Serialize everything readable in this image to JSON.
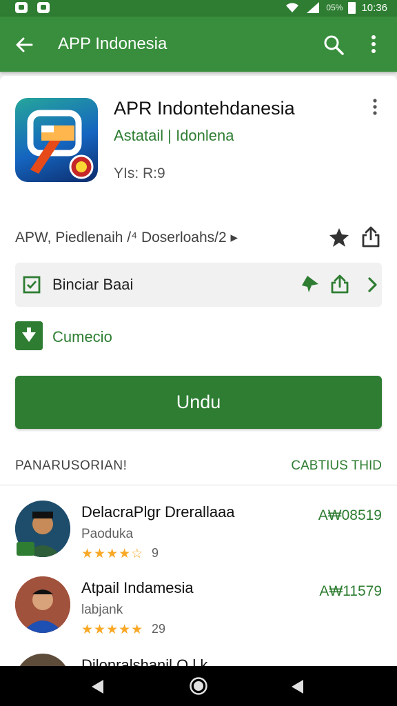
{
  "status_bar": {
    "time": "10:36",
    "battery_text": "05%"
  },
  "app_bar": {
    "title": "APP Indonesia"
  },
  "app": {
    "name": "APR Indontehdanesia",
    "developer": "Astatail | Idonlena",
    "version": "YIs: R:9",
    "meta": "APW, Piedlenaih  /⁴ Doserloahs/2  ▸"
  },
  "option_row": {
    "label": "Binciar Baai"
  },
  "download_row": {
    "label": "Cumecio"
  },
  "primary_button": {
    "label": "Undu"
  },
  "section": {
    "left": "PANARUSORIAN!",
    "right": "CABTIUS THID"
  },
  "list": [
    {
      "title": "DelacraPlgr Drerallaaa",
      "subtitle": "Paoduka",
      "stars": "★★★★☆",
      "count": "9",
      "price": "A₩08519"
    },
    {
      "title": "Atpail Indamesia",
      "subtitle": "labjank",
      "stars": "★★★★★",
      "count": "29",
      "price": "A₩11579"
    },
    {
      "title": "Dilonralshanil O.l.k",
      "subtitle": "",
      "stars": "",
      "count": "",
      "price": ""
    }
  ],
  "colors": {
    "primary": "#388e3c",
    "primary_dark": "#2e7d32",
    "star": "#f9a825"
  }
}
